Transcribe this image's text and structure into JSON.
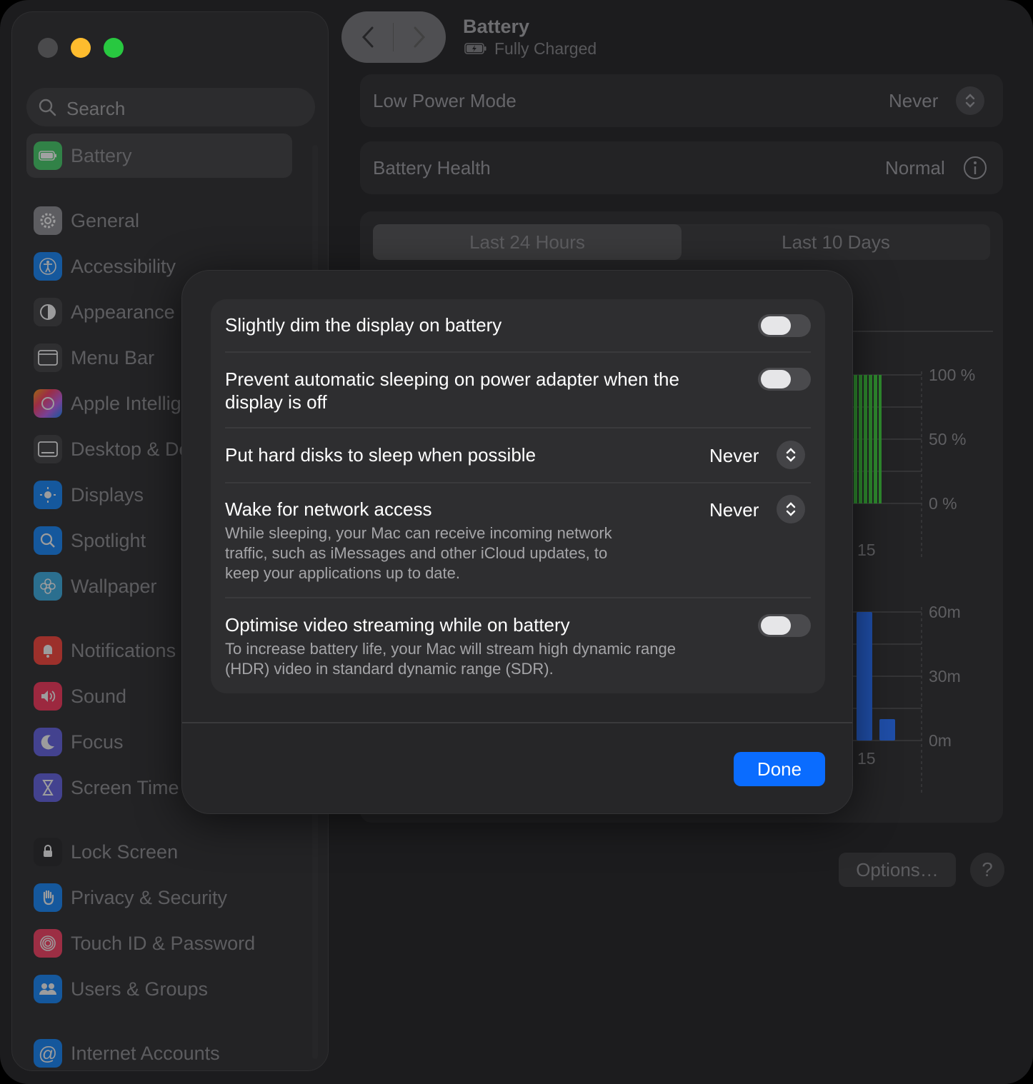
{
  "sidebar": {
    "search_placeholder": "Search",
    "selected": {
      "label": "Battery",
      "icon": "battery-icon",
      "color": "#34c759"
    },
    "items": [
      {
        "label": "General",
        "icon": "gear-icon",
        "color": "#8e8e93"
      },
      {
        "label": "Accessibility",
        "icon": "accessibility-icon",
        "color": "#0a84ff"
      },
      {
        "label": "Appearance",
        "icon": "appearance-icon",
        "color": "#3a3a3c"
      },
      {
        "label": "Menu Bar",
        "icon": "menu-bar-icon",
        "color": "#3a3a3c"
      },
      {
        "label": "Apple Intellig",
        "icon": "apple-intelligence-icon",
        "color": "#ff6b3d"
      },
      {
        "label": "Desktop & Do",
        "icon": "desktop-dock-icon",
        "color": "#3a3a3c"
      },
      {
        "label": "Displays",
        "icon": "displays-icon",
        "color": "#0a84ff"
      },
      {
        "label": "Spotlight",
        "icon": "spotlight-icon",
        "color": "#0a84ff"
      },
      {
        "label": "Wallpaper",
        "icon": "wallpaper-icon",
        "color": "#32ade6"
      },
      {
        "label": "Notifications",
        "icon": "notifications-icon",
        "color": "#ff3b30"
      },
      {
        "label": "Sound",
        "icon": "sound-icon",
        "color": "#ff2d55"
      },
      {
        "label": "Focus",
        "icon": "focus-icon",
        "color": "#5e5ce6"
      },
      {
        "label": "Screen Time",
        "icon": "screen-time-icon",
        "color": "#5e5ce6"
      },
      {
        "label": "Lock Screen",
        "icon": "lock-screen-icon",
        "color": "#1c1c1e"
      },
      {
        "label": "Privacy & Security",
        "icon": "privacy-hand-icon",
        "color": "#0a84ff"
      },
      {
        "label": "Touch ID & Password",
        "icon": "fingerprint-icon",
        "color": "#ff375f"
      },
      {
        "label": "Users & Groups",
        "icon": "users-icon",
        "color": "#0a84ff"
      },
      {
        "label": "Internet Accounts",
        "icon": "at-icon",
        "color": "#0a84ff"
      }
    ]
  },
  "header": {
    "title": "Battery",
    "subtitle": "Fully Charged"
  },
  "main": {
    "low_power": {
      "label": "Low Power Mode",
      "value": "Never"
    },
    "health": {
      "label": "Battery Health",
      "value": "Normal"
    },
    "tabs": [
      "Last 24 Hours",
      "Last 10 Days"
    ],
    "chart_labels": {
      "level": [
        "100 %",
        "50 %",
        "0 %"
      ],
      "usage": [
        "60m",
        "30m",
        "0m"
      ],
      "x_tick": "15"
    },
    "options_label": "Options…",
    "help_label": "?"
  },
  "sheet": {
    "dim_display": {
      "title": "Slightly dim the display on battery",
      "on": false
    },
    "prevent_sleep": {
      "title_1": "Prevent automatic sleeping on power adapter when the",
      "title_2": "display is off",
      "on": false
    },
    "hard_disks": {
      "title": "Put hard disks to sleep when possible",
      "value": "Never"
    },
    "wake_network": {
      "title": "Wake for network access",
      "value": "Never",
      "desc_1": "While sleeping, your Mac can receive incoming network",
      "desc_2": "traffic, such as iMessages and other iCloud updates, to",
      "desc_3": "keep your applications up to date."
    },
    "video_streaming": {
      "title": "Optimise video streaming while on battery",
      "desc_1": "To increase battery life, your Mac will stream high dynamic range",
      "desc_2": "(HDR) video in standard dynamic range (SDR).",
      "on": false
    },
    "done_label": "Done"
  }
}
